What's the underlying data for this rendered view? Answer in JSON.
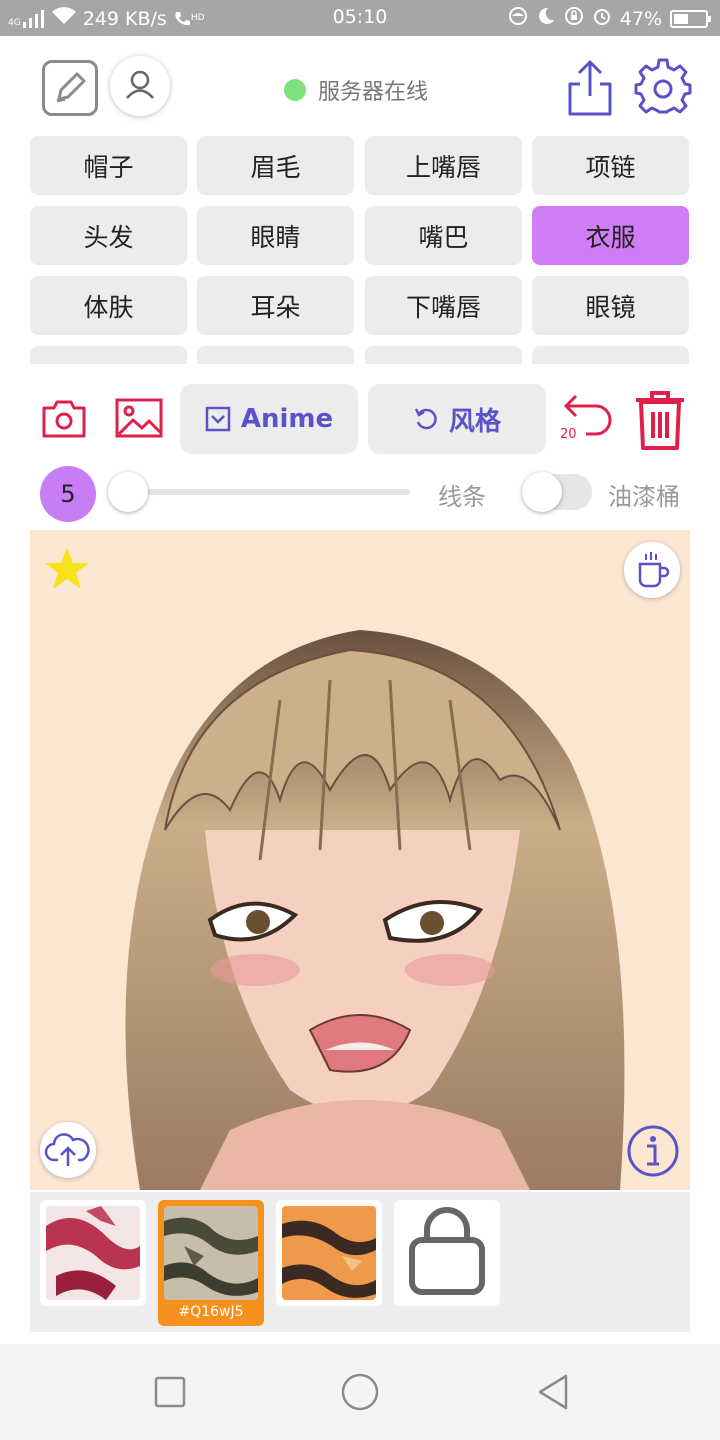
{
  "status_bar": {
    "network": "4G",
    "speed": "249 KB/s",
    "hd": "HD",
    "time": "05:10",
    "battery_text": "47%",
    "battery_level": 0.47
  },
  "header": {
    "server_status": "服务器在线",
    "server_status_color": "#7ee37a"
  },
  "parts": [
    {
      "label": "帽子",
      "active": false
    },
    {
      "label": "眉毛",
      "active": false
    },
    {
      "label": "上嘴唇",
      "active": false
    },
    {
      "label": "项链",
      "active": false
    },
    {
      "label": "头发",
      "active": false
    },
    {
      "label": "眼睛",
      "active": false
    },
    {
      "label": "嘴巴",
      "active": false
    },
    {
      "label": "衣服",
      "active": true
    },
    {
      "label": "体肤",
      "active": false
    },
    {
      "label": "耳朵",
      "active": false
    },
    {
      "label": "下嘴唇",
      "active": false
    },
    {
      "label": "眼镜",
      "active": false
    }
  ],
  "toolbar": {
    "model_label": "Anime",
    "style_label": "风格",
    "undo_count": "20"
  },
  "brush": {
    "size": "5",
    "slider_level": 0.05,
    "lines_label": "线条",
    "bucket_label": "油漆桶",
    "bucket_toggle_on": false
  },
  "palette": {
    "selected_code": "#Q16wJ5"
  },
  "colors": {
    "accent_purple": "#d07cf5",
    "accent_red": "#e0204a",
    "accent_indigo": "#5a52c8"
  }
}
